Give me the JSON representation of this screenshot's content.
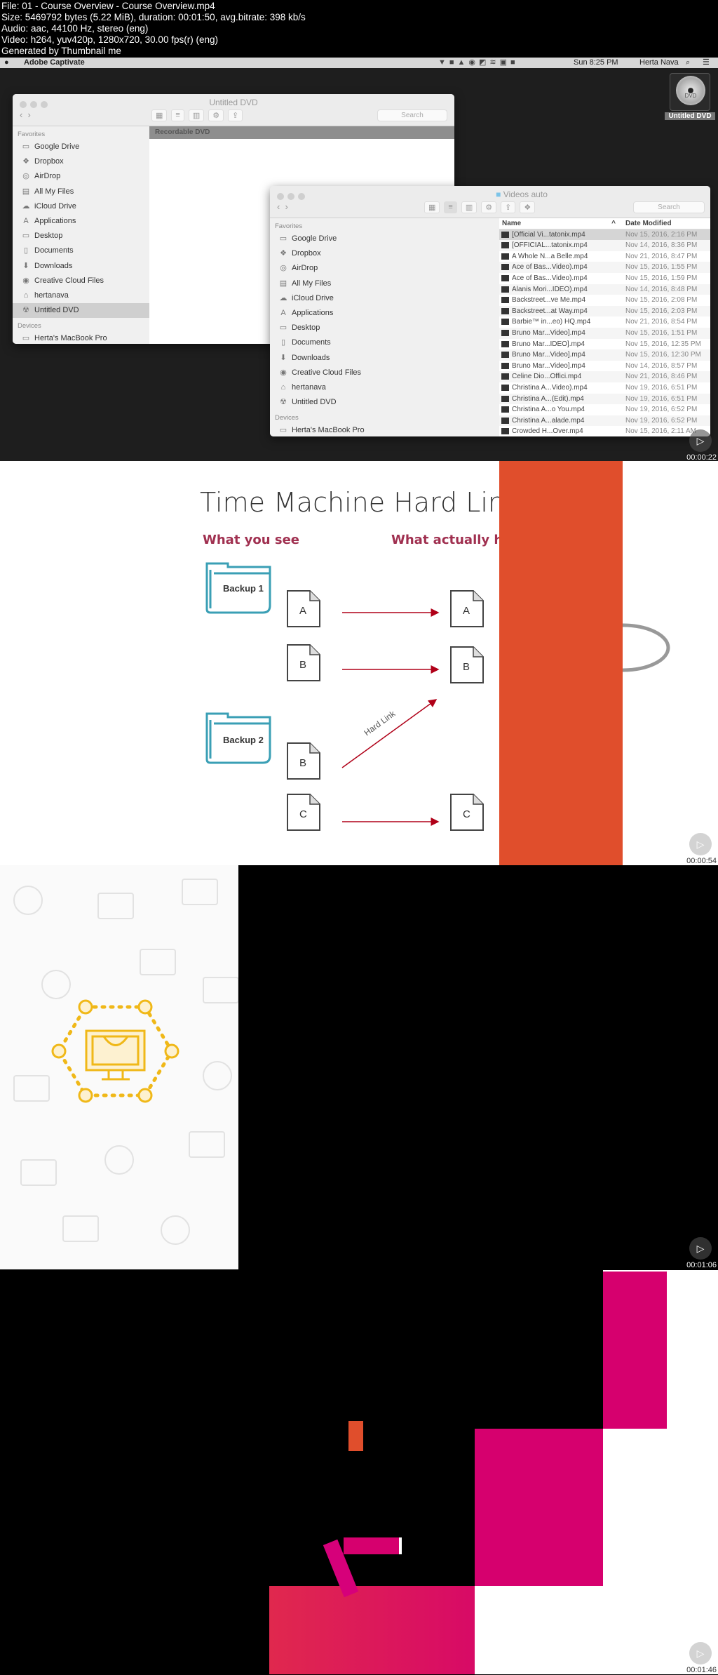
{
  "info": {
    "lines": [
      "File: 01 - Course Overview - Course Overview.mp4",
      "Size: 5469792 bytes (5.22 MiB), duration: 00:01:50, avg.bitrate: 398 kb/s",
      "Audio: aac, 44100 Hz, stereo (eng)",
      "Video: h264, yuv420p, 1280x720, 30.00 fps(r) (eng)",
      "Generated by Thumbnail me"
    ]
  },
  "frames": [
    {
      "timestamp": "00:00:22",
      "menubar": {
        "app": "Adobe Captivate",
        "clock": "Sun 8:25 PM",
        "user": "Herta Nava"
      },
      "desktop_icon": {
        "label": "Untitled DVD",
        "disc_text": "DVD"
      },
      "window1": {
        "title": "Untitled DVD",
        "search": "Search",
        "banner": "Recordable DVD",
        "favorites_label": "Favorites",
        "devices_label": "Devices",
        "favorites": [
          "Google Drive",
          "Dropbox",
          "AirDrop",
          "All My Files",
          "iCloud Drive",
          "Applications",
          "Desktop",
          "Documents",
          "Downloads",
          "Creative Cloud Files",
          "hertanava",
          "Untitled DVD"
        ],
        "devices": [
          "Herta's MacBook Pro"
        ]
      },
      "window2": {
        "title": "Videos auto",
        "search": "Search",
        "favorites_label": "Favorites",
        "devices_label": "Devices",
        "favorites": [
          "Google Drive",
          "Dropbox",
          "AirDrop",
          "All My Files",
          "iCloud Drive",
          "Applications",
          "Desktop",
          "Documents",
          "Downloads",
          "Creative Cloud Files",
          "hertanava",
          "Untitled DVD"
        ],
        "devices": [
          "Herta's MacBook Pro"
        ],
        "columns": [
          "Name",
          "Date Modified"
        ],
        "files": [
          {
            "name": "[Official Vi...tatonix.mp4",
            "date": "Nov 15, 2016, 2:16 PM"
          },
          {
            "name": "[OFFICIAL...tatonix.mp4",
            "date": "Nov 14, 2016, 8:36 PM"
          },
          {
            "name": "A Whole N...a Belle.mp4",
            "date": "Nov 21, 2016, 8:47 PM"
          },
          {
            "name": "Ace of Bas...Video).mp4",
            "date": "Nov 15, 2016, 1:55 PM"
          },
          {
            "name": "Ace of Bas...Video).mp4",
            "date": "Nov 15, 2016, 1:59 PM"
          },
          {
            "name": "Alanis Mori...IDEO).mp4",
            "date": "Nov 14, 2016, 8:48 PM"
          },
          {
            "name": "Backstreet...ve Me.mp4",
            "date": "Nov 15, 2016, 2:08 PM"
          },
          {
            "name": "Backstreet...at Way.mp4",
            "date": "Nov 15, 2016, 2:03 PM"
          },
          {
            "name": "Barbie™ in...eo) HQ.mp4",
            "date": "Nov 21, 2016, 8:54 PM"
          },
          {
            "name": "Bruno Mar...Video].mp4",
            "date": "Nov 15, 2016, 1:51 PM"
          },
          {
            "name": "Bruno Mar...IDEO].mp4",
            "date": "Nov 15, 2016, 12:35 PM"
          },
          {
            "name": "Bruno Mar...Video].mp4",
            "date": "Nov 15, 2016, 12:30 PM"
          },
          {
            "name": "Bruno Mar...Video].mp4",
            "date": "Nov 14, 2016, 8:57 PM"
          },
          {
            "name": "Celine Dio...Offici.mp4",
            "date": "Nov 21, 2016, 8:46 PM"
          },
          {
            "name": "Christina A...Video).mp4",
            "date": "Nov 19, 2016, 6:51 PM"
          },
          {
            "name": "Christina A...(Edit).mp4",
            "date": "Nov 19, 2016, 6:51 PM"
          },
          {
            "name": "Christina A...o You.mp4",
            "date": "Nov 19, 2016, 6:52 PM"
          },
          {
            "name": "Christina A...alade.mp4",
            "date": "Nov 19, 2016, 6:52 PM"
          },
          {
            "name": "Crowded H...Over.mp4",
            "date": "Nov 15, 2016, 2:11 AM"
          }
        ]
      }
    },
    {
      "timestamp": "00:00:54",
      "slide": {
        "title": "Time Machine Hard Link",
        "left_heading": "What you see",
        "right_heading": "What actually ha",
        "backup1": "Backup 1",
        "backup2": "Backup 2",
        "file_a": "A",
        "file_b": "B",
        "file_c": "C",
        "hard_link": "Hard Link"
      },
      "colors": {
        "heading": "#a03050",
        "arrow": "#b00018",
        "folder": "#3a9fb5",
        "overlay": "#e04e2c"
      }
    },
    {
      "timestamp": "00:01:06",
      "colors": {
        "icon": "#f0b818"
      }
    },
    {
      "timestamp": "00:01:46",
      "colors": {
        "pink": "#d6006e",
        "red": "#e0284e",
        "orange": "#e04e2c"
      }
    }
  ]
}
